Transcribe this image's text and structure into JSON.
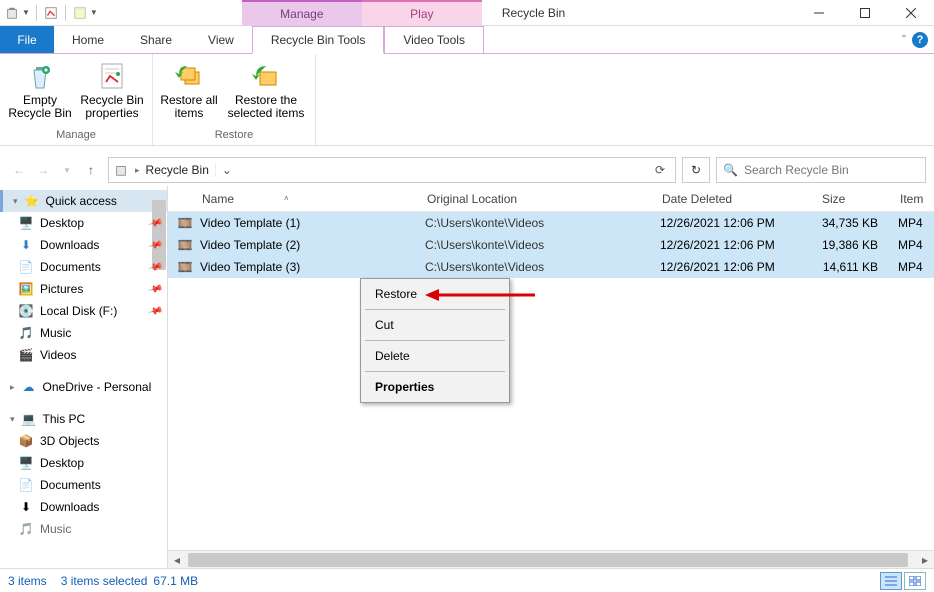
{
  "titlebar": {
    "title": "Recycle Bin"
  },
  "context_tabs": {
    "manage": "Manage",
    "play": "Play"
  },
  "tabs": {
    "file": "File",
    "home": "Home",
    "share": "Share",
    "view": "View",
    "rbtools": "Recycle Bin Tools",
    "videotools": "Video Tools"
  },
  "ribbon": {
    "empty": "Empty Recycle Bin",
    "props": "Recycle Bin properties",
    "restore_all": "Restore all items",
    "restore_sel": "Restore the selected items",
    "group_manage": "Manage",
    "group_restore": "Restore"
  },
  "breadcrumb": {
    "root": "Recycle Bin"
  },
  "search": {
    "placeholder": "Search Recycle Bin"
  },
  "columns": {
    "name": "Name",
    "orig": "Original Location",
    "deleted": "Date Deleted",
    "size": "Size",
    "type": "Item"
  },
  "rows": [
    {
      "name": "Video Template (1)",
      "orig": "C:\\Users\\konte\\Videos",
      "deleted": "12/26/2021 12:06 PM",
      "size": "34,735 KB",
      "type": "MP4"
    },
    {
      "name": "Video Template (2)",
      "orig": "C:\\Users\\konte\\Videos",
      "deleted": "12/26/2021 12:06 PM",
      "size": "19,386 KB",
      "type": "MP4"
    },
    {
      "name": "Video Template (3)",
      "orig": "C:\\Users\\konte\\Videos",
      "deleted": "12/26/2021 12:06 PM",
      "size": "14,611 KB",
      "type": "MP4"
    }
  ],
  "sidebar": {
    "quick": "Quick access",
    "desktop": "Desktop",
    "downloads": "Downloads",
    "documents": "Documents",
    "pictures": "Pictures",
    "localdisk": "Local Disk (F:)",
    "music": "Music",
    "videos": "Videos",
    "onedrive": "OneDrive - Personal",
    "thispc": "This PC",
    "objects3d": "3D Objects",
    "pc_desktop": "Desktop",
    "pc_documents": "Documents",
    "pc_downloads": "Downloads",
    "pc_music": "Music"
  },
  "contextmenu": {
    "restore": "Restore",
    "cut": "Cut",
    "delete": "Delete",
    "properties": "Properties"
  },
  "status": {
    "count": "3 items",
    "selected": "3 items selected",
    "size": "67.1 MB"
  }
}
